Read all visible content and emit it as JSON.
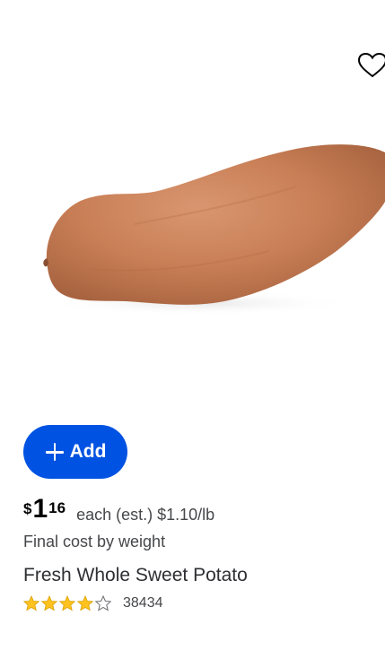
{
  "favorite": {
    "icon": "heart-outline-icon"
  },
  "product": {
    "image": {
      "subject": "sweet-potato",
      "colors": {
        "skin": "#c8825a",
        "shadow": "#9a5b3a"
      }
    },
    "add_button": {
      "icon": "plus-icon",
      "label": "Add",
      "color": "#0053e2"
    },
    "price": {
      "currency": "$",
      "whole": "1",
      "cents": "16",
      "unit_text": "each (est.) $1.10/lb"
    },
    "final_cost_note": "Final cost by weight",
    "title": "Fresh Whole Sweet Potato",
    "rating": {
      "stars_filled": 4,
      "stars_total": 5,
      "star_color": "#ffc220",
      "review_count": "38434"
    }
  }
}
